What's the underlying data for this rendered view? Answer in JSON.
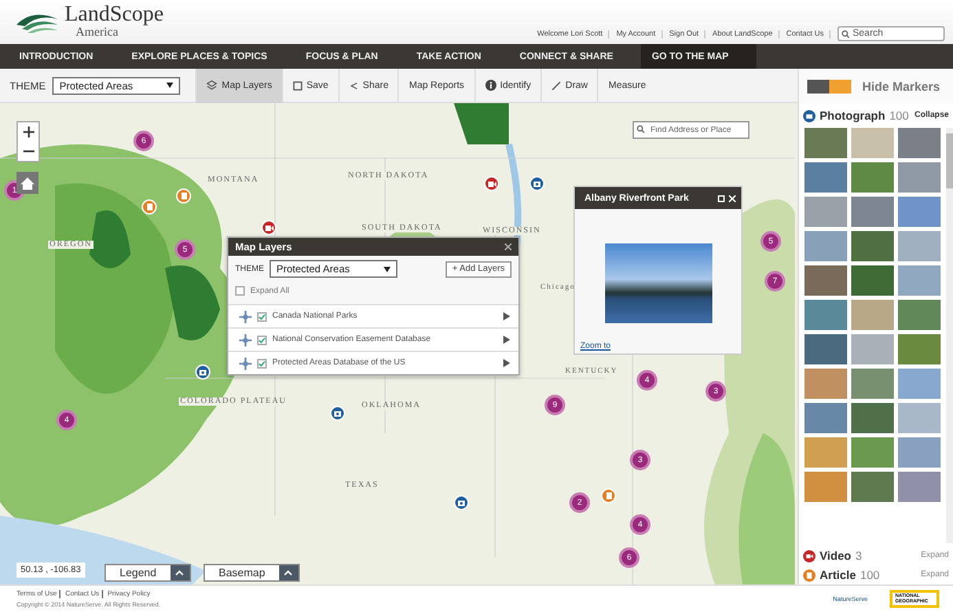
{
  "header": {
    "logo_title": "LandScope",
    "logo_subtitle": "America",
    "user_links": [
      "Welcome Lori Scott",
      "My Account",
      "Sign Out",
      "About LandScope",
      "Contact Us"
    ],
    "search": {
      "placeholder": "Search"
    }
  },
  "nav": [
    {
      "label": "INTRODUCTION",
      "selected": false
    },
    {
      "label": "EXPLORE PLACES & TOPICS",
      "selected": false
    },
    {
      "label": "FOCUS & PLAN",
      "selected": false
    },
    {
      "label": "TAKE ACTION",
      "selected": false
    },
    {
      "label": "CONNECT & SHARE",
      "selected": false
    },
    {
      "label": "GO TO THE MAP",
      "selected": true
    }
  ],
  "toolbar": {
    "theme_label": "THEME",
    "theme_value": "Protected Areas",
    "tools": [
      {
        "kind": "layers",
        "label": "Map Layers",
        "selected": true
      },
      {
        "kind": "save",
        "label": "Save",
        "selected": false
      },
      {
        "kind": "share",
        "label": "Share",
        "selected": false
      },
      {
        "kind": "plain",
        "label": "Map Reports",
        "selected": false
      },
      {
        "kind": "info",
        "label": "Identify",
        "selected": false
      },
      {
        "kind": "draw",
        "label": "Draw",
        "selected": false
      },
      {
        "kind": "plain",
        "label": "Measure",
        "selected": false
      }
    ]
  },
  "map": {
    "find_field": {
      "placeholder": "Find Address or Place"
    },
    "labels": [
      "MONTANA",
      "NORTH DAKOTA",
      "SOUTH DAKOTA",
      "WISCONSIN",
      "OREGON",
      "COLORADO PLATEAU",
      "OKLAHOMA",
      "TEXAS",
      "Chicago",
      "KENTUCKY"
    ],
    "clusters": [
      "6",
      "1",
      "5",
      "4",
      "4",
      "9",
      "3",
      "3",
      "2",
      "4",
      "6",
      "5",
      "7"
    ],
    "markers": [
      {
        "kind": "article"
      },
      {
        "kind": "article"
      },
      {
        "kind": "video"
      },
      {
        "kind": "video"
      },
      {
        "kind": "photo"
      },
      {
        "kind": "photo"
      },
      {
        "kind": "photo"
      },
      {
        "kind": "article"
      },
      {
        "kind": "photo"
      }
    ],
    "coordinates": "50.13 , -106.83",
    "legend_button": "Legend",
    "basemap_button": "Basemap",
    "layers_panel": {
      "title": "Map Layers",
      "theme_label": "THEME",
      "theme_value": "Protected Areas",
      "add_button": "+ Add Layers",
      "expand_all": {
        "label": "Expand All",
        "checked": false
      },
      "layers": [
        {
          "name": "Canada National Parks",
          "checked": true
        },
        {
          "name": "National Conservation Easement Database",
          "checked": true
        },
        {
          "name": "Protected Areas Database of the US",
          "checked": true
        }
      ]
    },
    "popup": {
      "title": "Albany Riverfront Park",
      "link": "Zoom to"
    }
  },
  "sidebar": {
    "hide_markers": "Hide Markers",
    "categories": [
      {
        "kind": "photo",
        "name": "Photograph",
        "count": "100",
        "action": "Collapse",
        "expanded": true,
        "color": "#1f5f9e"
      },
      {
        "kind": "video",
        "name": "Video",
        "count": "3",
        "action": "Expand",
        "expanded": false,
        "color": "#c62828"
      },
      {
        "kind": "article",
        "name": "Article",
        "count": "100",
        "action": "Expand",
        "expanded": false,
        "color": "#e67e22"
      }
    ]
  },
  "footer": {
    "links": [
      "Terms of Use",
      "Contact Us",
      "Privacy Policy"
    ],
    "copyright": "Copyright © 2014 NatureServe. All Rights Reserved.",
    "partner_1": "NatureServe",
    "partner_2": "NATIONAL GEOGRAPHIC"
  }
}
